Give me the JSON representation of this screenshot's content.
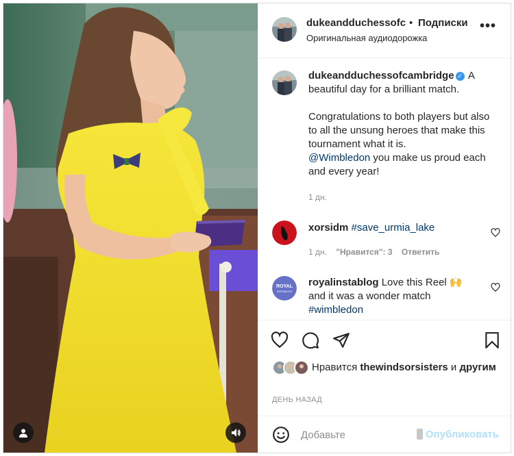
{
  "post": {
    "author": "dukeandduchessofcambridge",
    "author_truncated": "dukeandduchessofc",
    "follow_separator": "•",
    "follow_label": "Подписки",
    "audio_label": "Оригинальная аудиодорожка",
    "more_label": "•••"
  },
  "caption": {
    "username": "dukeandduchessofcambridge",
    "verified_mark": "✓",
    "line1": "A beautiful day for a brilliant match.",
    "line2": "Congratulations to both players but also to all the unsung heroes that make this tournament what it is.",
    "mention": "@Wimbledon",
    "line3": " you make us proud each and every year!",
    "time": "1 дн."
  },
  "comments": [
    {
      "username": "xorsidm",
      "hashtag": "#save_urmia_lake",
      "time": "1 дн.",
      "likes": "\"Нравится\": 3",
      "reply": "Ответить"
    },
    {
      "username": "royalinstablog",
      "text": "Love this Reel 🙌 and it was a wonder match ",
      "hashtag": "#wimbledon",
      "avatar_text": "ROYAL"
    }
  ],
  "likes": {
    "prefix": "Нравится",
    "user": "thewindsorsisters",
    "and": "и",
    "others": "другим"
  },
  "posted_ago": "ДЕНЬ НАЗАД",
  "comment_box": {
    "placeholder": "Добавьте",
    "publish_label": "Опубликовать"
  },
  "colors": {
    "accent": "#0095f6",
    "publish_disabled": "#b2dffc",
    "link": "#00376b",
    "meta": "#8e8e8e",
    "dress": "#f2e12a"
  },
  "icons": {
    "user_tag": "person-icon",
    "audio": "speaker-icon",
    "like": "heart-icon",
    "comment": "comment-icon",
    "share": "paper-plane-icon",
    "save": "bookmark-icon",
    "emoji": "smiley-icon"
  }
}
